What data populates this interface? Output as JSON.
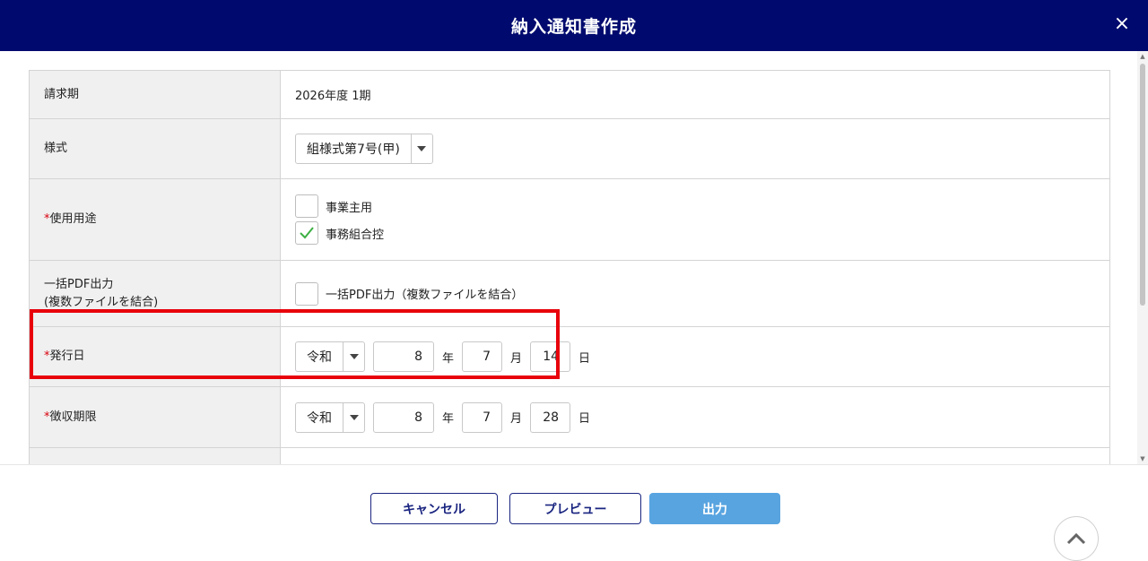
{
  "header": {
    "title": "納入通知書作成",
    "close_glyph": "×"
  },
  "form": {
    "billing_period": {
      "label": "請求期",
      "value": "2026年度 1期"
    },
    "format": {
      "label": "様式",
      "selected": "組様式第7号(甲)"
    },
    "usage": {
      "required_mark": "*",
      "label": "使用用途",
      "options": [
        {
          "label": "事業主用",
          "checked": false
        },
        {
          "label": "事務組合控",
          "checked": true
        }
      ]
    },
    "bulk_pdf": {
      "label_line1": "一括PDF出力",
      "label_line2": "(複数ファイルを結合)",
      "checkbox_label": "一括PDF出力（複数ファイルを結合）",
      "checked": false
    },
    "issue_date": {
      "required_mark": "*",
      "label": "発行日",
      "era": "令和",
      "year": "8",
      "year_unit": "年",
      "month": "7",
      "month_unit": "月",
      "day": "14",
      "day_unit": "日"
    },
    "due_date": {
      "required_mark": "*",
      "label": "徴収期限",
      "era": "令和",
      "year": "8",
      "year_unit": "年",
      "month": "7",
      "month_unit": "月",
      "day": "28",
      "day_unit": "日"
    }
  },
  "footer": {
    "cancel_label": "キャンセル",
    "preview_label": "プレビュー",
    "output_label": "出力"
  },
  "colors": {
    "header_bg": "#000a6e",
    "highlight": "#e8000b",
    "primary": "#58a4e0",
    "outline": "#1a2580",
    "check": "#3cb043"
  },
  "icons": {
    "close": "close-icon",
    "dropdown": "caret-down-icon",
    "check": "check-icon",
    "back_to_top": "chevron-up-icon"
  }
}
